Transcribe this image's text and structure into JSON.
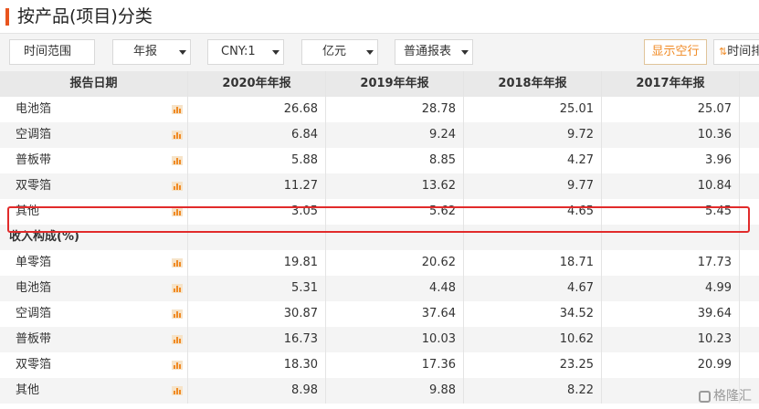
{
  "title": "按产品(项目)分类",
  "toolbar": {
    "time_range": "时间范围",
    "report_type": "年报",
    "currency": "CNY:1",
    "unit": "亿元",
    "statement": "普通报表",
    "show_empty": "显示空行",
    "time_sort": "时间排",
    "sort_icon": "sort-arrows-icon"
  },
  "table": {
    "columns": [
      "报告日期",
      "2020年年报",
      "2019年年报",
      "2018年年报",
      "2017年年报"
    ],
    "top_rows": [
      {
        "label": "电池箔",
        "values": [
          "26.68",
          "28.78",
          "25.01",
          "25.07"
        ]
      },
      {
        "label": "空调箔",
        "values": [
          "6.84",
          "9.24",
          "9.72",
          "10.36"
        ]
      },
      {
        "label": "普板带",
        "values": [
          "5.88",
          "8.85",
          "4.27",
          "3.96"
        ]
      },
      {
        "label": "双零箔",
        "values": [
          "11.27",
          "13.62",
          "9.77",
          "10.84"
        ]
      },
      {
        "label": "其他",
        "values": [
          "3.05",
          "5.62",
          "4.65",
          "5.45"
        ]
      }
    ],
    "section": {
      "label": "收入构成(%)"
    },
    "bottom_rows": [
      {
        "label": "单零箔",
        "values": [
          "19.81",
          "20.62",
          "18.71",
          "17.73"
        ]
      },
      {
        "label": "电池箔",
        "values": [
          "5.31",
          "4.48",
          "4.67",
          "4.99"
        ]
      },
      {
        "label": "空调箔",
        "values": [
          "30.87",
          "37.64",
          "34.52",
          "39.64"
        ]
      },
      {
        "label": "普板带",
        "values": [
          "16.73",
          "10.03",
          "10.62",
          "10.23"
        ]
      },
      {
        "label": "双零箔",
        "values": [
          "18.30",
          "17.36",
          "23.25",
          "20.99"
        ]
      },
      {
        "label": "其他",
        "values": [
          "8.98",
          "9.88",
          "8.22",
          ""
        ]
      }
    ]
  },
  "watermark": "格隆汇",
  "colors": {
    "accent": "#e8541e",
    "highlight": "#e12b2b",
    "orange": "#f08a24"
  }
}
